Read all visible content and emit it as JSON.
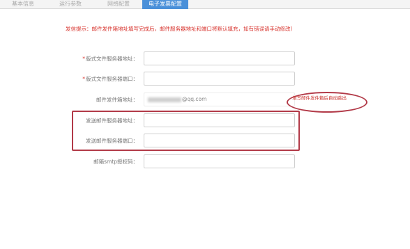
{
  "tabs": [
    {
      "label": "基本信息",
      "active": false
    },
    {
      "label": "运行参数",
      "active": false
    },
    {
      "label": "网络配置",
      "active": false
    },
    {
      "label": "电子发票配置",
      "active": true
    }
  ],
  "hint": "发信提示：邮件发件箱地址填写完成后，邮件服务器地址和端口将默认填充，如有错误请手动修改）",
  "fields": [
    {
      "label": "版式文件服务器地址：",
      "required": true,
      "value": ""
    },
    {
      "label": "版式文件服务器端口：",
      "required": true,
      "value": ""
    },
    {
      "label": "邮件发件箱地址：",
      "required": false,
      "value": "@qq.com"
    },
    {
      "label": "发送邮件服务器地址：",
      "required": false,
      "value": ""
    },
    {
      "label": "发送邮件服务器端口：",
      "required": false,
      "value": ""
    },
    {
      "label": "邮箱smtp授权码：",
      "required": false,
      "value": ""
    }
  ],
  "required_mark": "*",
  "annotation": "填写邮件发件箱后自动跳出",
  "colors": {
    "accent": "#4a90d9",
    "warning": "#d7322c",
    "annotation": "#b23a48"
  }
}
